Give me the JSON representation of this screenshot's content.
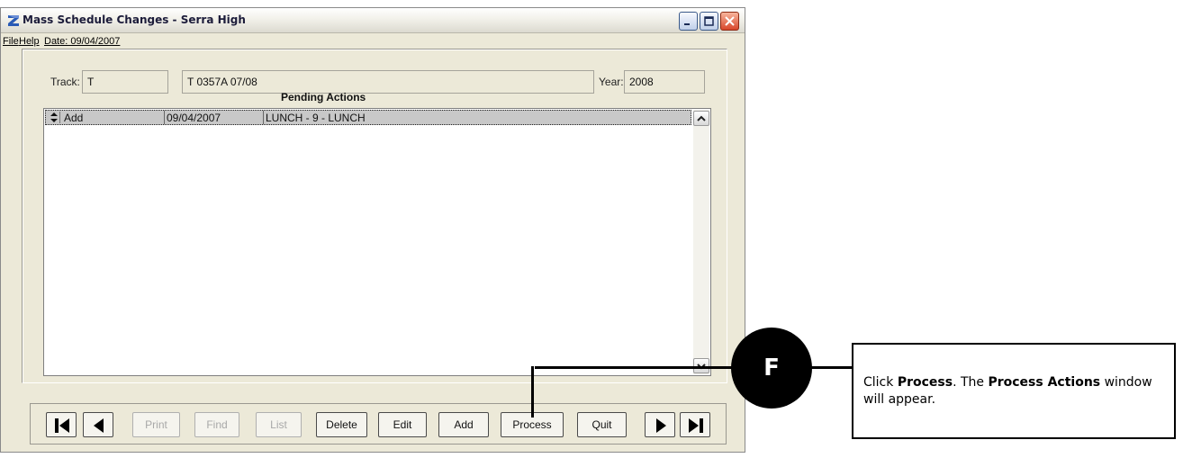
{
  "window": {
    "title": "Mass Schedule Changes - Serra High"
  },
  "menu": {
    "file": "File",
    "help": "Help",
    "date": "Date: 09/04/2007"
  },
  "form": {
    "track_label": "Track:",
    "track_value": "T",
    "track_description": "T 0357A 07/08",
    "year_label": "Year:",
    "year_value": "2008"
  },
  "pending": {
    "title": "Pending Actions",
    "rows": [
      {
        "action": "Add",
        "date": "09/04/2007",
        "description": "LUNCH - 9 - LUNCH"
      }
    ]
  },
  "toolbar": {
    "print": "Print",
    "find": "Find",
    "list": "List",
    "delete": "Delete",
    "edit": "Edit",
    "add": "Add",
    "process": "Process",
    "quit": "Quit"
  },
  "callout": {
    "badge": "F",
    "text_1": "Click ",
    "bold_1": "Process",
    "text_2": ". The ",
    "bold_2": "Process Actions",
    "text_3": " window will appear."
  },
  "colors": {
    "window_bg": "#ece9d8",
    "selected_row": "#c8c8c8",
    "close_button": "#d8462a"
  },
  "icons": [
    "app-logo-icon",
    "minimize-icon",
    "maximize-icon",
    "close-icon",
    "sort-toggle-icon",
    "scroll-up-icon",
    "scroll-down-icon",
    "first-record-icon",
    "previous-record-icon",
    "next-record-icon",
    "last-record-icon"
  ]
}
